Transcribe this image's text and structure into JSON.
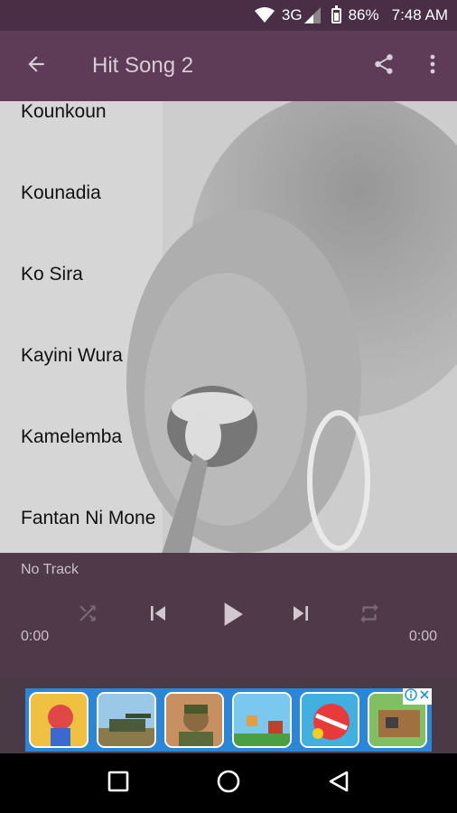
{
  "status_bar": {
    "network": "3G",
    "battery": "86%",
    "time": "7:48 AM",
    "icons": [
      "wifi-icon",
      "signal-icon",
      "battery-icon"
    ]
  },
  "app_bar": {
    "title": "Hit Song 2",
    "back_icon": "arrow-back-icon",
    "share_icon": "share-icon",
    "menu_icon": "more-vert-icon"
  },
  "tracks": [
    {
      "title": "Kounkoun"
    },
    {
      "title": "Kounadia"
    },
    {
      "title": "Ko Sira"
    },
    {
      "title": "Kayini Wura"
    },
    {
      "title": "Kamelemba"
    },
    {
      "title": "Fantan Ni Mone"
    }
  ],
  "player": {
    "now_playing": "No Track",
    "elapsed": "0:00",
    "duration": "0:00",
    "controls": [
      "shuffle-icon",
      "skip-previous-icon",
      "play-icon",
      "skip-next-icon",
      "repeat-icon"
    ]
  },
  "ad": {
    "badge_icons": [
      "info-icon",
      "close-icon"
    ],
    "tiles": [
      "game-tile-1",
      "game-tile-2",
      "game-tile-3",
      "game-tile-4",
      "game-tile-5",
      "game-tile-6"
    ]
  },
  "nav_bar": {
    "icons": [
      "recent-apps-icon",
      "home-icon",
      "back-icon"
    ]
  },
  "colors": {
    "app_bar": "#5e3c57",
    "status_bar": "#4a2e45",
    "player": "#563e50",
    "ad_banner": "#2a86d8"
  }
}
